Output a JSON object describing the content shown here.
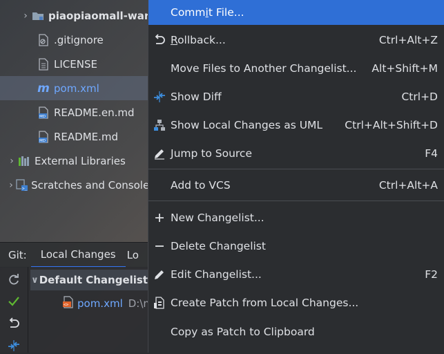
{
  "project_tree": {
    "items": [
      {
        "label": "piaopiaomall-ware",
        "icon": "folder-module-icon",
        "has_chevron": true
      },
      {
        "label": ".gitignore",
        "icon": "gitignore-file-icon",
        "has_chevron": false
      },
      {
        "label": "LICENSE",
        "icon": "text-file-icon",
        "has_chevron": false
      },
      {
        "label": "pom.xml",
        "icon": "maven-icon",
        "has_chevron": false,
        "selected": true
      },
      {
        "label": "README.en.md",
        "icon": "markdown-file-icon",
        "has_chevron": false
      },
      {
        "label": "README.md",
        "icon": "markdown-file-icon",
        "has_chevron": false
      },
      {
        "label": "External Libraries",
        "icon": "libraries-icon",
        "has_chevron": true
      },
      {
        "label": "Scratches and Consoles",
        "icon": "scratches-icon",
        "has_chevron": true
      }
    ]
  },
  "git_panel": {
    "prefix": "Git:",
    "tabs": [
      {
        "label": "Local Changes",
        "active": true
      },
      {
        "label": "Lo"
      }
    ],
    "changelist": {
      "label": "Default Changelist"
    },
    "files": [
      {
        "name": "pom.xml",
        "path": "D:\\m"
      }
    ],
    "toolbar_icons": [
      "refresh-icon",
      "commit-check-icon",
      "rollback-icon",
      "diff-icon"
    ]
  },
  "context_menu": {
    "items": [
      {
        "type": "item",
        "label_pre": "Comm",
        "mnemonic": "i",
        "label_post": "t File...",
        "shortcut": "",
        "icon": "",
        "highlighted": true
      },
      {
        "type": "item",
        "label_pre": "",
        "mnemonic": "R",
        "label_post": "ollback...",
        "shortcut": "Ctrl+Alt+Z",
        "icon": "rollback-icon"
      },
      {
        "type": "item",
        "label_pre": "Move Files to Another Changelist...",
        "mnemonic": "",
        "label_post": "",
        "shortcut": "Alt+Shift+M",
        "icon": ""
      },
      {
        "type": "item",
        "label_pre": "Show Diff",
        "mnemonic": "",
        "label_post": "",
        "shortcut": "Ctrl+D",
        "icon": "diff-icon"
      },
      {
        "type": "item",
        "label_pre": "Show Local Changes as UML",
        "mnemonic": "",
        "label_post": "",
        "shortcut": "Ctrl+Alt+Shift+D",
        "icon": "uml-icon"
      },
      {
        "type": "item",
        "label_pre": "Jump to Source",
        "mnemonic": "",
        "label_post": "",
        "shortcut": "F4",
        "icon": "edit-pencil-icon"
      },
      {
        "type": "separator"
      },
      {
        "type": "item",
        "label_pre": "Add to VCS",
        "mnemonic": "",
        "label_post": "",
        "shortcut": "Ctrl+Alt+A",
        "icon": ""
      },
      {
        "type": "separator"
      },
      {
        "type": "item",
        "label_pre": "New Changelist...",
        "mnemonic": "",
        "label_post": "",
        "shortcut": "",
        "icon": "plus-icon"
      },
      {
        "type": "item",
        "label_pre": "Delete Changelist",
        "mnemonic": "",
        "label_post": "",
        "shortcut": "",
        "icon": "minus-icon"
      },
      {
        "type": "item",
        "label_pre": "Edit Changelist...",
        "mnemonic": "",
        "label_post": "",
        "shortcut": "F2",
        "icon": "edit-pencil-icon"
      },
      {
        "type": "item",
        "label_pre": "Create Patch from Local Changes...",
        "mnemonic": "",
        "label_post": "",
        "shortcut": "",
        "icon": "patch-icon"
      },
      {
        "type": "item",
        "label_pre": "Copy as Patch to Clipboard",
        "mnemonic": "",
        "label_post": "",
        "shortcut": "",
        "icon": ""
      }
    ]
  },
  "colors": {
    "menu_bg": "#2b2d30",
    "highlight": "#2f6fd6",
    "text": "#dfe1e5",
    "link_blue": "#6fa8ff",
    "diff_blue": "#3d8fe0",
    "check_green": "#5fb832"
  }
}
